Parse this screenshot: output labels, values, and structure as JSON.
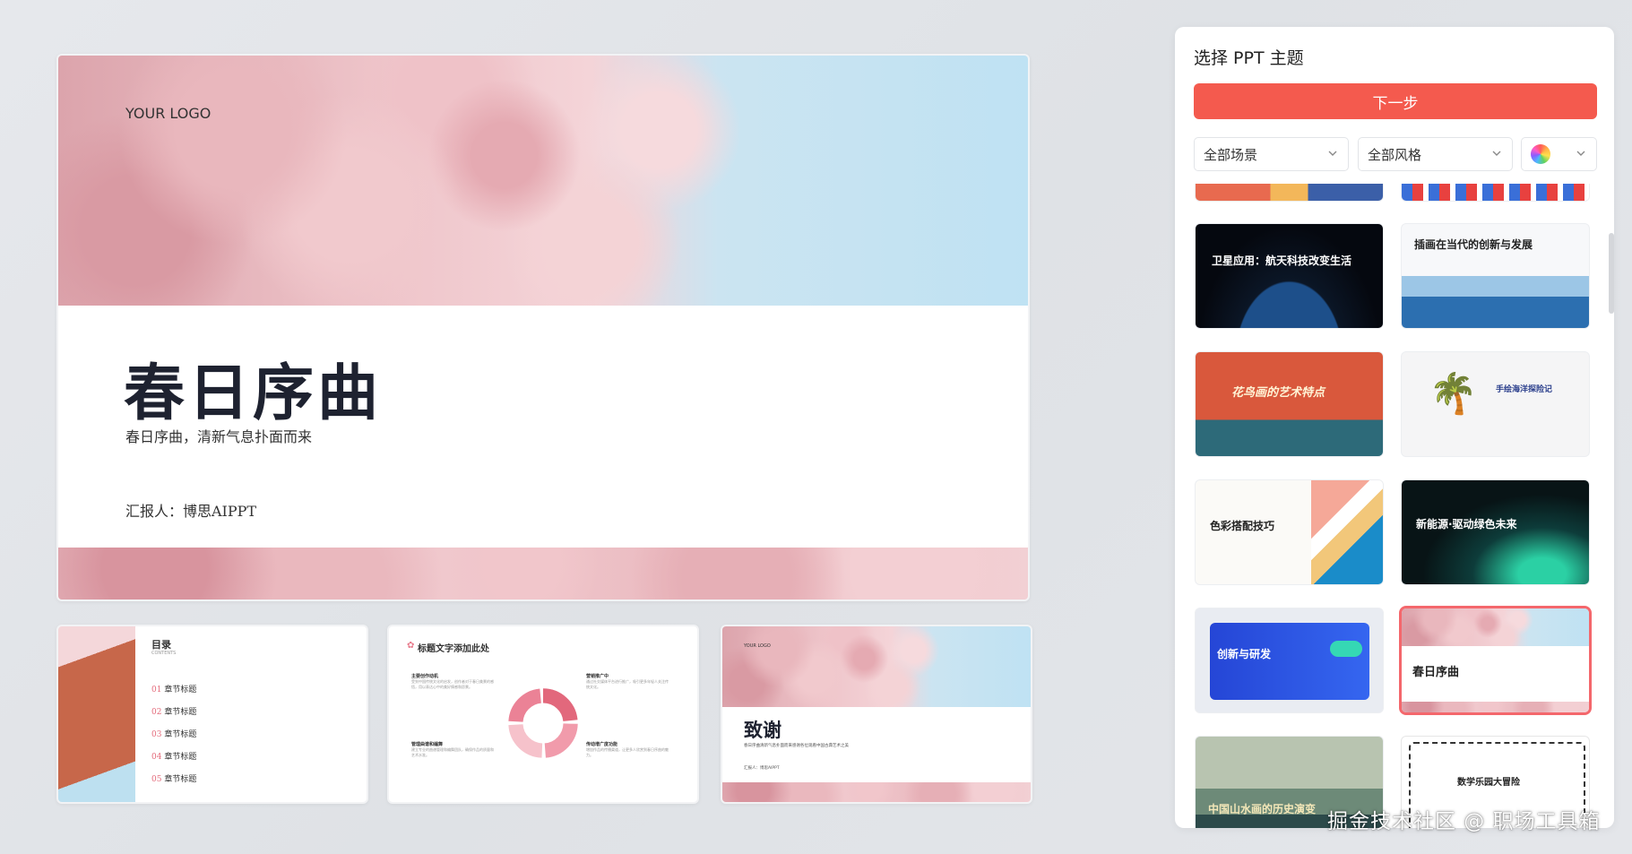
{
  "main_slide": {
    "logo": "YOUR LOGO",
    "title": "春日序曲",
    "subtitle": "春日序曲，清新气息扑面而来",
    "reporter": "汇报人：博思AIPPT"
  },
  "slide_toc": {
    "title": "目录",
    "subtitle": "CONTENTS",
    "items": [
      {
        "num": "01",
        "label": "章节标题"
      },
      {
        "num": "02",
        "label": "章节标题"
      },
      {
        "num": "03",
        "label": "章节标题"
      },
      {
        "num": "04",
        "label": "章节标题"
      },
      {
        "num": "05",
        "label": "章节标题"
      }
    ]
  },
  "slide_content": {
    "title": "标题文字添加此处",
    "blocks": [
      {
        "heading": "主要创作动机",
        "text": "受到中国传统文化的启发，创作者对于春日美景的感悟，用以表达心中的美好情感和愿景。"
      },
      {
        "heading": "营销推广中",
        "text": "通过社交媒体平台进行推广，吸引更多年轻人关注传统文化。"
      },
      {
        "heading": "管理曲谱和编舞",
        "text": "建立专业的曲谱管理和编舞团队，确保作品的质量和艺术水准。"
      },
      {
        "heading": "传动增广度功能",
        "text": "增加作品的传播渠道，让更多人欣赏到春日序曲的魅力。"
      }
    ]
  },
  "slide_thanks": {
    "logo": "YOUR LOGO",
    "title": "致谢",
    "subtitle": "春日序曲清新气息扑面而来感谢各位观看中国古典艺术之美",
    "reporter": "汇报人：博思AIPPT"
  },
  "panel": {
    "title": "选择 PPT 主题",
    "next_button": "下一步",
    "scene_select": "全部场景",
    "style_select": "全部风格",
    "themes": [
      {
        "title": "卫星应用：航天科技改变生活"
      },
      {
        "title": "插画在当代的创新与发展"
      },
      {
        "title": "花鸟画的艺术特点"
      },
      {
        "title": "手绘海洋探险记"
      },
      {
        "title": "色彩搭配技巧"
      },
      {
        "title": "新能源·驱动绿色未来"
      },
      {
        "title": "创新与研发"
      },
      {
        "title": "春日序曲"
      },
      {
        "title": "中国山水画的历史演变"
      },
      {
        "title": "数学乐园大冒险"
      }
    ]
  },
  "watermark": "掘金技术社区 @ 职场工具箱",
  "colors": {
    "accent": "#f45a4e",
    "selected_border": "#f4676c"
  }
}
